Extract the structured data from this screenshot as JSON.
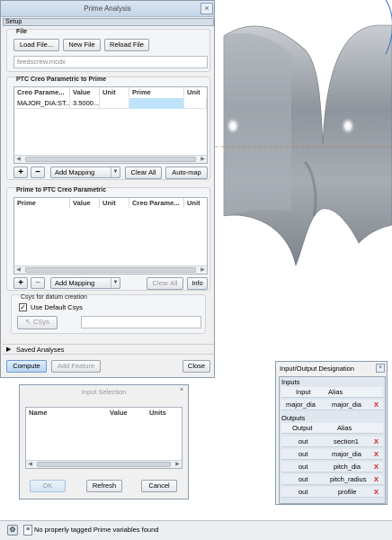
{
  "main_dialog": {
    "title": "Prime Analysis",
    "setup_tab": "Setup",
    "file_group": {
      "label": "File",
      "load_button": "Load File...",
      "new_button": "New File",
      "reload_button": "Reload File",
      "file_name": "feedscrew.mcdx"
    },
    "creo_to_prime": {
      "label": "PTC Creo Parametric to Prime",
      "columns": [
        "Creo Parame...",
        "Value",
        "Unit",
        "Prime",
        "Unit"
      ],
      "rows": [
        {
          "creo": "MAJOR_DIA:ST...",
          "value": "3.5000...",
          "unit": "",
          "prime": "",
          "prime_unit": ""
        }
      ],
      "add_mapping": "Add Mapping",
      "clear_all": "Clear All",
      "auto_map": "Auto-map"
    },
    "prime_to_creo": {
      "label": "Prime to PTC Creo Parametric",
      "columns": [
        "Prime",
        "Value",
        "Unit",
        "Creo Parame...",
        "Unit"
      ],
      "add_mapping": "Add Mapping",
      "clear_all": "Clear All",
      "info": "Info"
    },
    "csys_group": {
      "label": "Csys for datum creation",
      "use_default": "Use Default Csys",
      "csys_button": "CSys"
    },
    "saved_analyses": "Saved Analyses",
    "compute": "Compute",
    "add_feature": "Add Feature",
    "close": "Close"
  },
  "io_designation": {
    "title": "Input/Output Designation",
    "inputs_label": "Inputs",
    "input_header": {
      "input": "Input",
      "alias": "Alias"
    },
    "inputs": [
      {
        "name": "major_dia",
        "alias": "major_dia"
      }
    ],
    "outputs_label": "Outputs",
    "output_header": {
      "output": "Output",
      "alias": "Alias"
    },
    "outputs": [
      {
        "name": "out",
        "alias": "section1"
      },
      {
        "name": "out",
        "alias": "major_dia"
      },
      {
        "name": "out",
        "alias": "pitch_dia"
      },
      {
        "name": "out",
        "alias": "pitch_radius"
      },
      {
        "name": "out",
        "alias": "profile"
      }
    ],
    "remove_glyph": "X"
  },
  "input_selection": {
    "title": "Input Selection",
    "columns": [
      "Name",
      "Value",
      "Units"
    ],
    "ok": "OK",
    "refresh": "Refresh",
    "cancel": "Cancel"
  },
  "status_bar": {
    "message": "No properly tagged Prime variables found"
  },
  "colors": {
    "dialog_bg": "#f0f0f0",
    "selected_cell": "#bfe3fb",
    "model_gray": "#9ea4ab",
    "accent_blue": "#b8d4f3",
    "remove_red": "#d02020"
  }
}
